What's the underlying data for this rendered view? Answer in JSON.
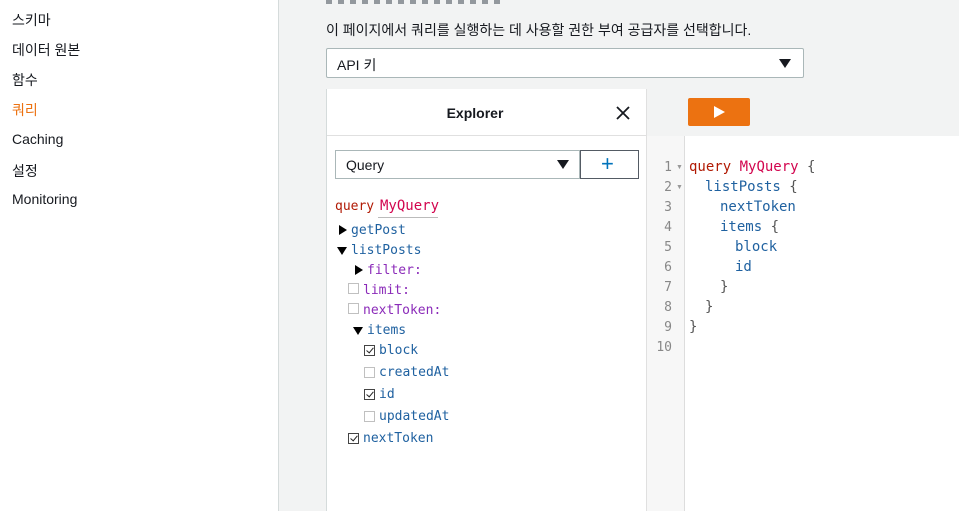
{
  "sidebar": {
    "items": [
      {
        "label": "스키마",
        "active": false
      },
      {
        "label": "데이터 원본",
        "active": false
      },
      {
        "label": "함수",
        "active": false
      },
      {
        "label": "쿼리",
        "active": true
      },
      {
        "label": "Caching",
        "active": false
      },
      {
        "label": "설정",
        "active": false
      },
      {
        "label": "Monitoring",
        "active": false
      }
    ]
  },
  "auth": {
    "description": "이 페이지에서 쿼리를 실행하는 데 사용할 권한 부여 공급자를 선택합니다.",
    "selected": "API 키"
  },
  "explorer": {
    "title": "Explorer",
    "operation_type": "Query",
    "add_label": "+",
    "query_keyword": "query",
    "operation_name": "MyQuery",
    "fields": {
      "getPost": "getPost",
      "listPosts": "listPosts",
      "filter": "filter:",
      "limit": "limit:",
      "nextToken_arg": "nextToken:",
      "items": "items",
      "block": "block",
      "createdAt": "createdAt",
      "id": "id",
      "updatedAt": "updatedAt",
      "nextToken": "nextToken"
    },
    "checked": {
      "limit": false,
      "nextToken_arg": false,
      "block": true,
      "createdAt": false,
      "id": true,
      "updatedAt": false,
      "nextToken": true
    }
  },
  "editor": {
    "run_icon": "play-icon",
    "line_numbers": [
      "1",
      "2",
      "3",
      "4",
      "5",
      "6",
      "7",
      "8",
      "9",
      "10"
    ],
    "lines": {
      "l1_kw": "query",
      "l1_name": "MyQuery",
      "l1_brace": "{",
      "l2": "listPosts",
      "l2_brace": "{",
      "l3": "nextToken",
      "l4": "items",
      "l4_brace": "{",
      "l5": "block",
      "l6": "id",
      "l7": "}",
      "l8": "}",
      "l9": "}"
    }
  },
  "colors": {
    "accent": "#ec7211",
    "keyword": "#b11a04",
    "field": "#1f61a0",
    "operation": "#d2054e",
    "argument": "#8b2bb9"
  }
}
